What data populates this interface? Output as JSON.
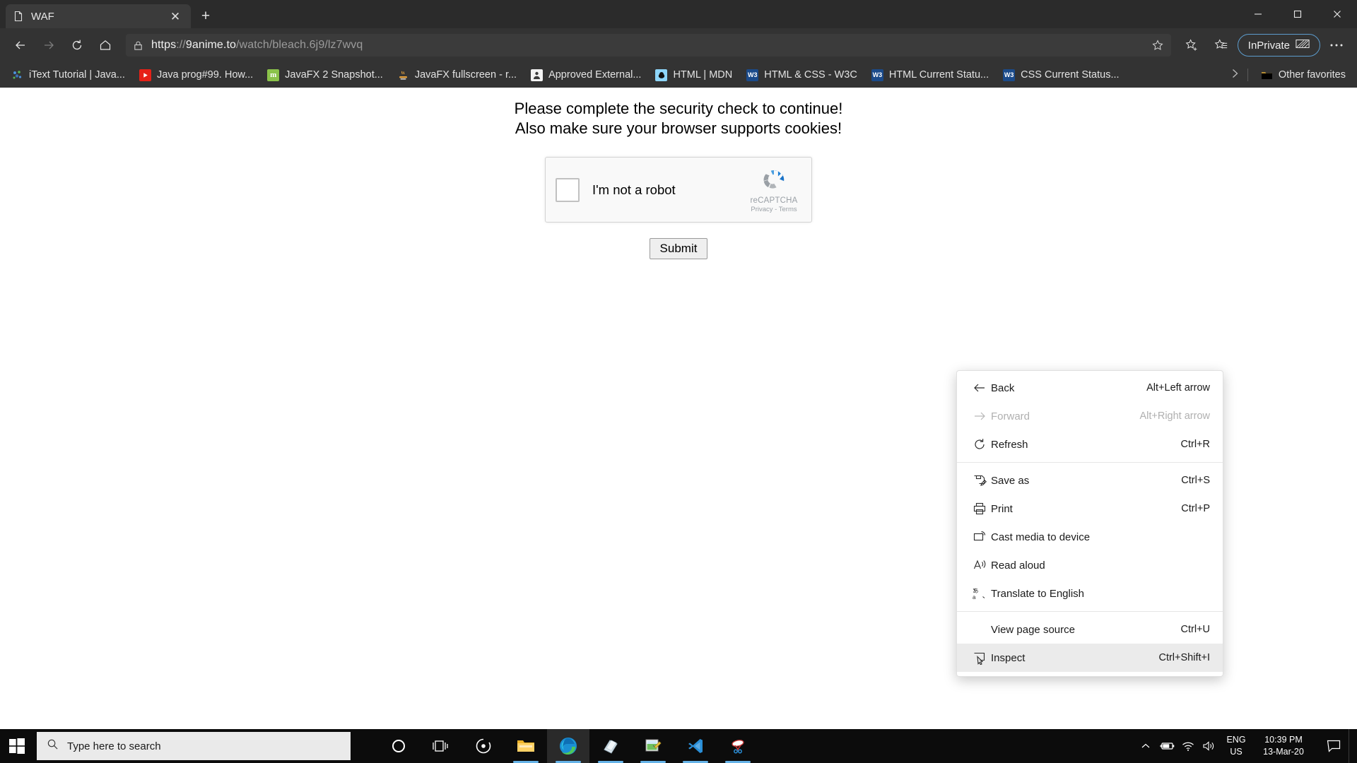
{
  "window": {
    "minimize_label": "─",
    "maximize_label": "☐",
    "close_label": "✕"
  },
  "tabs": [
    {
      "title": "WAF",
      "favicon": "document-icon",
      "close_label": "✕"
    }
  ],
  "newtab_label": "+",
  "nav": {
    "back_label": "Back",
    "forward_label": "Forward",
    "refresh_label": "Refresh",
    "home_label": "Home",
    "favorite_label": "Add this page to favorites",
    "collections_label": "Collections",
    "inprivate_label": "InPrivate",
    "settings_label": "Settings and more"
  },
  "address": {
    "scheme": "https",
    "separator": "://",
    "host": "9anime.to",
    "path": "/watch/bleach.6j9/lz7wvq",
    "full": "https://9anime.to/watch/bleach.6j9/lz7wvq",
    "lock_icon": "lock-icon"
  },
  "bookmarks": {
    "items": [
      {
        "label": "iText Tutorial | Java...",
        "icon_text": "",
        "icon_bg": "#2b2b2b",
        "icon_fg": "#4a90d9",
        "icon_name": "itext-favicon"
      },
      {
        "label": "Java prog#99. How...",
        "icon_text": "▶",
        "icon_bg": "#e62117",
        "icon_fg": "#ffffff",
        "icon_name": "youtube-favicon"
      },
      {
        "label": "JavaFX 2 Snapshot...",
        "icon_text": "m",
        "icon_bg": "#8bc34a",
        "icon_fg": "#ffffff",
        "icon_name": "mkyong-favicon"
      },
      {
        "label": "JavaFX fullscreen - r...",
        "icon_text": "☕",
        "icon_bg": "#333333",
        "icon_fg": "#e8a33d",
        "icon_name": "java-favicon"
      },
      {
        "label": "Approved External...",
        "icon_text": "⚙",
        "icon_bg": "#f2f2f2",
        "icon_fg": "#444444",
        "icon_name": "approved-favicon"
      },
      {
        "label": "HTML | MDN",
        "icon_text": "●",
        "icon_bg": "#8ed6fb",
        "icon_fg": "#111111",
        "icon_name": "mdn-favicon"
      },
      {
        "label": "HTML & CSS - W3C",
        "icon_text": "W3",
        "icon_bg": "#1a4a8a",
        "icon_fg": "#ffffff",
        "icon_name": "w3c-favicon"
      },
      {
        "label": "HTML Current Statu...",
        "icon_text": "W3",
        "icon_bg": "#1a4a8a",
        "icon_fg": "#ffffff",
        "icon_name": "w3c-favicon"
      },
      {
        "label": "CSS Current Status...",
        "icon_text": "W3",
        "icon_bg": "#1a4a8a",
        "icon_fg": "#ffffff",
        "icon_name": "w3c-favicon"
      }
    ],
    "overflow_label": "›",
    "other_favorites_label": "Other favorites"
  },
  "content": {
    "line1": "Please complete the security check to continue!",
    "line2": "Also make sure your browser supports cookies!",
    "recaptcha": {
      "checkbox_label": "I'm not a robot",
      "brand": "reCAPTCHA",
      "privacy": "Privacy",
      "dash": "-",
      "terms": "Terms",
      "legal": "Privacy - Terms"
    },
    "submit_label": "Submit"
  },
  "context_menu": {
    "items": [
      {
        "label": "Back",
        "shortcut": "Alt+Left arrow",
        "icon": "arrow-left-icon",
        "disabled": false,
        "highlighted": false,
        "separator_after": false
      },
      {
        "label": "Forward",
        "shortcut": "Alt+Right arrow",
        "icon": "arrow-right-icon",
        "disabled": true,
        "highlighted": false,
        "separator_after": false
      },
      {
        "label": "Refresh",
        "shortcut": "Ctrl+R",
        "icon": "refresh-icon",
        "disabled": false,
        "highlighted": false,
        "separator_after": true
      },
      {
        "label": "Save as",
        "shortcut": "Ctrl+S",
        "icon": "save-as-icon",
        "disabled": false,
        "highlighted": false,
        "separator_after": false
      },
      {
        "label": "Print",
        "shortcut": "Ctrl+P",
        "icon": "print-icon",
        "disabled": false,
        "highlighted": false,
        "separator_after": false
      },
      {
        "label": "Cast media to device",
        "shortcut": "",
        "icon": "cast-icon",
        "disabled": false,
        "highlighted": false,
        "separator_after": false
      },
      {
        "label": "Read aloud",
        "shortcut": "",
        "icon": "read-aloud-icon",
        "disabled": false,
        "highlighted": false,
        "separator_after": false
      },
      {
        "label": "Translate to English",
        "shortcut": "",
        "icon": "translate-icon",
        "disabled": false,
        "highlighted": false,
        "separator_after": true
      },
      {
        "label": "View page source",
        "shortcut": "Ctrl+U",
        "icon": "",
        "disabled": false,
        "highlighted": false,
        "separator_after": false
      },
      {
        "label": "Inspect",
        "shortcut": "Ctrl+Shift+I",
        "icon": "inspect-icon",
        "disabled": false,
        "highlighted": true,
        "separator_after": false
      }
    ]
  },
  "taskbar": {
    "start_label": "Start",
    "search_placeholder": "Type here to search",
    "apps": [
      {
        "name": "cortana-icon",
        "active": false,
        "running": false
      },
      {
        "name": "task-view-icon",
        "active": false,
        "running": false
      },
      {
        "name": "media-player-icon",
        "active": false,
        "running": false
      },
      {
        "name": "file-explorer-icon",
        "active": false,
        "running": true
      },
      {
        "name": "microsoft-edge-icon",
        "active": true,
        "running": true
      },
      {
        "name": "sticky-notes-icon",
        "active": false,
        "running": true
      },
      {
        "name": "paint-icon",
        "active": false,
        "running": true
      },
      {
        "name": "visual-studio-code-icon",
        "active": false,
        "running": true
      },
      {
        "name": "snipping-tool-icon",
        "active": false,
        "running": true
      }
    ],
    "tray": {
      "chevron_label": "∧",
      "battery_name": "battery-charging-icon",
      "network_name": "wifi-icon",
      "volume_name": "volume-icon",
      "lang_line1": "ENG",
      "lang_line2": "US",
      "time": "10:39 PM",
      "date": "13-Mar-20",
      "action_center_name": "action-center-icon"
    }
  },
  "colors": {
    "chrome_bg": "#333333",
    "titlebar_bg": "#2b2b2b",
    "tab_active_bg": "#3b3b3b",
    "accent": "#5c9ccd",
    "taskbar_bg": "#0c0c0c",
    "menu_bg": "#ffffff",
    "menu_highlight": "#ebebeb"
  }
}
